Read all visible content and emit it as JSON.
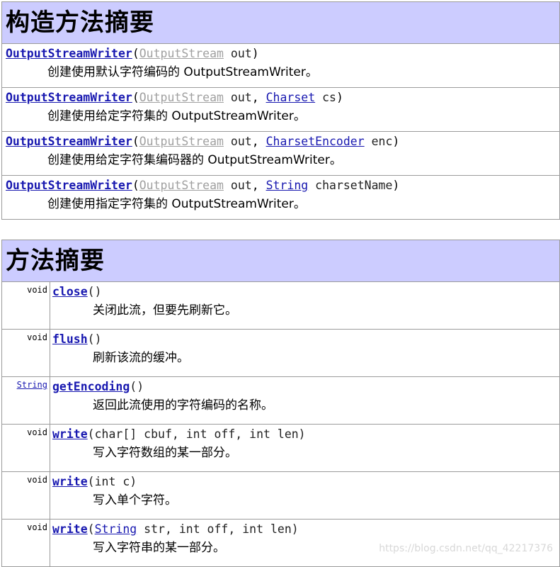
{
  "constructor_summary": {
    "title": "构造方法摘要",
    "rows": [
      {
        "name": "OutputStreamWriter",
        "params": [
          {
            "type": "OutputStream",
            "name": " out",
            "gray": true
          }
        ],
        "desc": "创建使用默认字符编码的 OutputStreamWriter。"
      },
      {
        "name": "OutputStreamWriter",
        "params": [
          {
            "type": "OutputStream",
            "name": " out",
            "gray": true
          },
          {
            "type": "Charset",
            "name": " cs",
            "gray": false
          }
        ],
        "desc": "创建使用给定字符集的 OutputStreamWriter。"
      },
      {
        "name": "OutputStreamWriter",
        "params": [
          {
            "type": "OutputStream",
            "name": " out",
            "gray": true
          },
          {
            "type": "CharsetEncoder",
            "name": " enc",
            "gray": false
          }
        ],
        "desc": "创建使用给定字符集编码器的 OutputStreamWriter。"
      },
      {
        "name": "OutputStreamWriter",
        "params": [
          {
            "type": "OutputStream",
            "name": " out",
            "gray": true
          },
          {
            "type": "String",
            "name": " charsetName",
            "gray": false
          }
        ],
        "desc": "创建使用指定字符集的 OutputStreamWriter。"
      }
    ]
  },
  "method_summary": {
    "title": "方法摘要",
    "rows": [
      {
        "ret": "void",
        "ret_link": false,
        "name": "close",
        "sig_prefix": "(",
        "sig_link": "",
        "sig_suffix": ")",
        "desc": "关闭此流，但要先刷新它。"
      },
      {
        "ret": "void",
        "ret_link": false,
        "name": "flush",
        "sig_prefix": "(",
        "sig_link": "",
        "sig_suffix": ")",
        "desc": "刷新该流的缓冲。"
      },
      {
        "ret": "String",
        "ret_link": true,
        "name": "getEncoding",
        "sig_prefix": "(",
        "sig_link": "",
        "sig_suffix": ")",
        "desc": "返回此流使用的字符编码的名称。"
      },
      {
        "ret": "void",
        "ret_link": false,
        "name": "write",
        "sig_prefix": "(char[] cbuf, int off, int len)",
        "sig_link": "",
        "sig_suffix": "",
        "desc": "写入字符数组的某一部分。"
      },
      {
        "ret": "void",
        "ret_link": false,
        "name": "write",
        "sig_prefix": "(int c)",
        "sig_link": "",
        "sig_suffix": "",
        "desc": "写入单个字符。"
      },
      {
        "ret": "void",
        "ret_link": false,
        "name": "write",
        "sig_prefix": "(",
        "sig_link": "String",
        "sig_suffix": " str, int off, int len)",
        "desc": "写入字符串的某一部分。"
      }
    ]
  },
  "watermark": "https://blog.csdn.net/qq_42217376"
}
